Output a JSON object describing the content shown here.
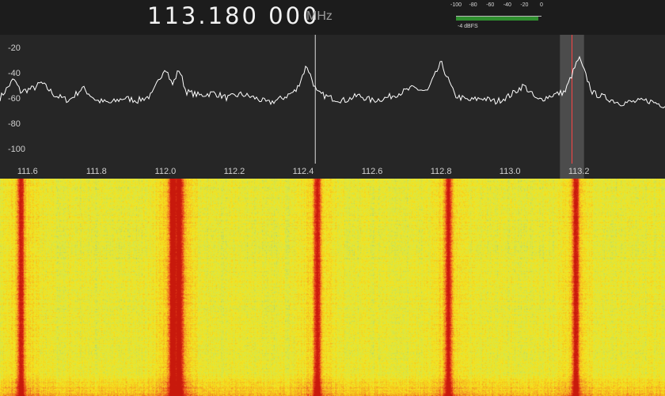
{
  "tuner": {
    "frequency": "113.180 000",
    "unit": "MHz"
  },
  "level_meter": {
    "scale_labels": [
      "-100",
      "-80",
      "-60",
      "-40",
      "-20",
      "0"
    ],
    "readout": "-4 dBFS",
    "level_dbfs": -4,
    "bar_color": "#2f8f2f"
  },
  "chart_data": {
    "type": "line",
    "title": "",
    "xlabel": "",
    "ylabel": "",
    "x_unit": "MHz",
    "xlim": [
      111.52,
      113.45
    ],
    "ylim": [
      -115,
      -10
    ],
    "x_ticks": [
      111.6,
      111.8,
      112.0,
      112.2,
      112.4,
      112.6,
      112.8,
      113.0,
      113.2
    ],
    "x_tick_labels": [
      "111.6",
      "111.8",
      "112.0",
      "112.2",
      "112.4",
      "112.6",
      "112.8",
      "113.0",
      "113.2"
    ],
    "y_ticks": [
      -20,
      -40,
      -60,
      -80,
      -100
    ],
    "y_tick_labels": [
      "-20",
      "-40",
      "-60",
      "-80",
      "-100"
    ],
    "grid": false,
    "noise_floor_db": -64,
    "series": [
      {
        "color": "#ffffff",
        "x": [
          111.52,
          111.56,
          111.58,
          111.62,
          111.64,
          111.68,
          111.72,
          111.76,
          111.8,
          111.84,
          111.88,
          111.92,
          111.96,
          112.0,
          112.02,
          112.04,
          112.06,
          112.1,
          112.14,
          112.18,
          112.22,
          112.26,
          112.3,
          112.34,
          112.38,
          112.41,
          112.44,
          112.48,
          112.52,
          112.56,
          112.6,
          112.64,
          112.68,
          112.72,
          112.76,
          112.8,
          112.84,
          112.88,
          112.92,
          112.96,
          113.0,
          113.04,
          113.08,
          113.12,
          113.16,
          113.2,
          113.24,
          113.28,
          113.32,
          113.36,
          113.4,
          113.45
        ],
        "y": [
          -60,
          -45,
          -55,
          -52,
          -48,
          -58,
          -62,
          -52,
          -62,
          -64,
          -60,
          -62,
          -58,
          -35,
          -50,
          -37,
          -55,
          -58,
          -56,
          -60,
          -57,
          -60,
          -64,
          -60,
          -54,
          -34,
          -56,
          -60,
          -62,
          -58,
          -62,
          -60,
          -56,
          -52,
          -55,
          -32,
          -58,
          -62,
          -60,
          -63,
          -58,
          -50,
          -62,
          -58,
          -55,
          -28,
          -56,
          -60,
          -64,
          -63,
          -62,
          -66
        ]
      }
    ],
    "markers": [
      {
        "x": 112.435,
        "color": "#dddddd"
      },
      {
        "x": 113.18,
        "color": "#ff4444"
      }
    ],
    "highlight_band": {
      "from": 113.145,
      "to": 113.215
    },
    "waterfall": {
      "signals_mhz": [
        111.58,
        112.02,
        112.04,
        112.44,
        112.82,
        113.19
      ],
      "colormap": [
        "#8fbf8a",
        "#d6e84a",
        "#f7e21b",
        "#f5a623",
        "#e8451c",
        "#c8190c"
      ]
    }
  }
}
